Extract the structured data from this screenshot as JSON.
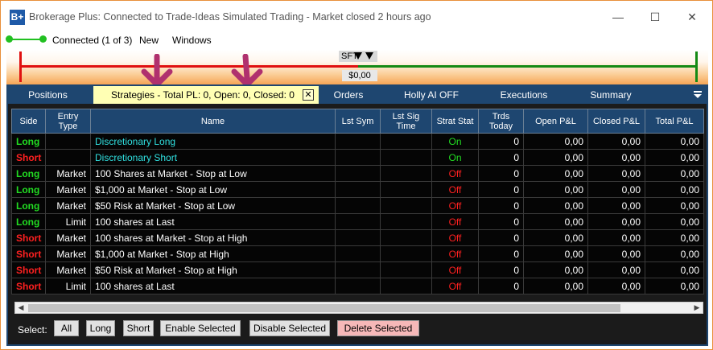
{
  "window": {
    "title": "Brokerage Plus: Connected to Trade-Ideas Simulated Trading - Market closed 2 hours ago",
    "icon_label": "B+",
    "controls": [
      "minimize-icon",
      "maximize-icon",
      "close-icon"
    ],
    "minimize_glyph": "—",
    "maximize_glyph": "☐",
    "close_glyph": "✕"
  },
  "menu": {
    "connection": "Connected (1 of 3)",
    "new": "New",
    "windows": "Windows"
  },
  "simbar": {
    "symbol_label": "SFT",
    "pl_label": "$0,00"
  },
  "tabs": [
    {
      "label": "Positions",
      "active": false
    },
    {
      "label": "Strategies - Total PL: 0, Open: 0, Closed: 0",
      "active": true
    },
    {
      "label": "Orders",
      "active": false
    },
    {
      "label": "Holly AI OFF",
      "active": false
    },
    {
      "label": "Executions",
      "active": false
    },
    {
      "label": "Summary",
      "active": false
    }
  ],
  "tab_close": "✕",
  "columns": [
    "Side",
    "Entry Type",
    "Name",
    "Lst Sym",
    "Lst Sig Time",
    "Strat Stat",
    "Trds Today",
    "Open P&L",
    "Closed P&L",
    "Total P&L"
  ],
  "rows": [
    {
      "side": "Long",
      "entry": "",
      "name": "Discretionary Long",
      "lst_sym": "",
      "lst_sig": "",
      "stat": "On",
      "trds": "0",
      "open": "0,00",
      "closed": "0,00",
      "total": "0,00"
    },
    {
      "side": "Short",
      "entry": "",
      "name": "Discretionary Short",
      "lst_sym": "",
      "lst_sig": "",
      "stat": "On",
      "trds": "0",
      "open": "0,00",
      "closed": "0,00",
      "total": "0,00"
    },
    {
      "side": "Long",
      "entry": "Market",
      "name": "100 Shares at Market - Stop at Low",
      "lst_sym": "",
      "lst_sig": "",
      "stat": "Off",
      "trds": "0",
      "open": "0,00",
      "closed": "0,00",
      "total": "0,00"
    },
    {
      "side": "Long",
      "entry": "Market",
      "name": "$1,000 at Market - Stop at Low",
      "lst_sym": "",
      "lst_sig": "",
      "stat": "Off",
      "trds": "0",
      "open": "0,00",
      "closed": "0,00",
      "total": "0,00"
    },
    {
      "side": "Long",
      "entry": "Market",
      "name": "$50 Risk at Market - Stop at Low",
      "lst_sym": "",
      "lst_sig": "",
      "stat": "Off",
      "trds": "0",
      "open": "0,00",
      "closed": "0,00",
      "total": "0,00"
    },
    {
      "side": "Long",
      "entry": "Limit",
      "name": "100 shares at Last",
      "lst_sym": "",
      "lst_sig": "",
      "stat": "Off",
      "trds": "0",
      "open": "0,00",
      "closed": "0,00",
      "total": "0,00"
    },
    {
      "side": "Short",
      "entry": "Market",
      "name": "100 shares at Market - Stop at High",
      "lst_sym": "",
      "lst_sig": "",
      "stat": "Off",
      "trds": "0",
      "open": "0,00",
      "closed": "0,00",
      "total": "0,00"
    },
    {
      "side": "Short",
      "entry": "Market",
      "name": "$1,000 at Market - Stop at High",
      "lst_sym": "",
      "lst_sig": "",
      "stat": "Off",
      "trds": "0",
      "open": "0,00",
      "closed": "0,00",
      "total": "0,00"
    },
    {
      "side": "Short",
      "entry": "Market",
      "name": "$50 Risk at Market - Stop at High",
      "lst_sym": "",
      "lst_sig": "",
      "stat": "Off",
      "trds": "0",
      "open": "0,00",
      "closed": "0,00",
      "total": "0,00"
    },
    {
      "side": "Short",
      "entry": "Limit",
      "name": "100 shares at Last",
      "lst_sym": "",
      "lst_sig": "",
      "stat": "Off",
      "trds": "0",
      "open": "0,00",
      "closed": "0,00",
      "total": "0,00"
    }
  ],
  "footer": {
    "select_label": "Select:",
    "buttons": [
      "All",
      "Long",
      "Short",
      "Enable Selected",
      "Disable Selected",
      "Delete Selected"
    ]
  },
  "colors": {
    "long": "#22dd22",
    "short": "#ff2020",
    "name_cyan": "#30e0e0",
    "header_bg": "#1e4670",
    "active_tab": "#ffffb4",
    "annotation_arrow": "#b0316e"
  }
}
